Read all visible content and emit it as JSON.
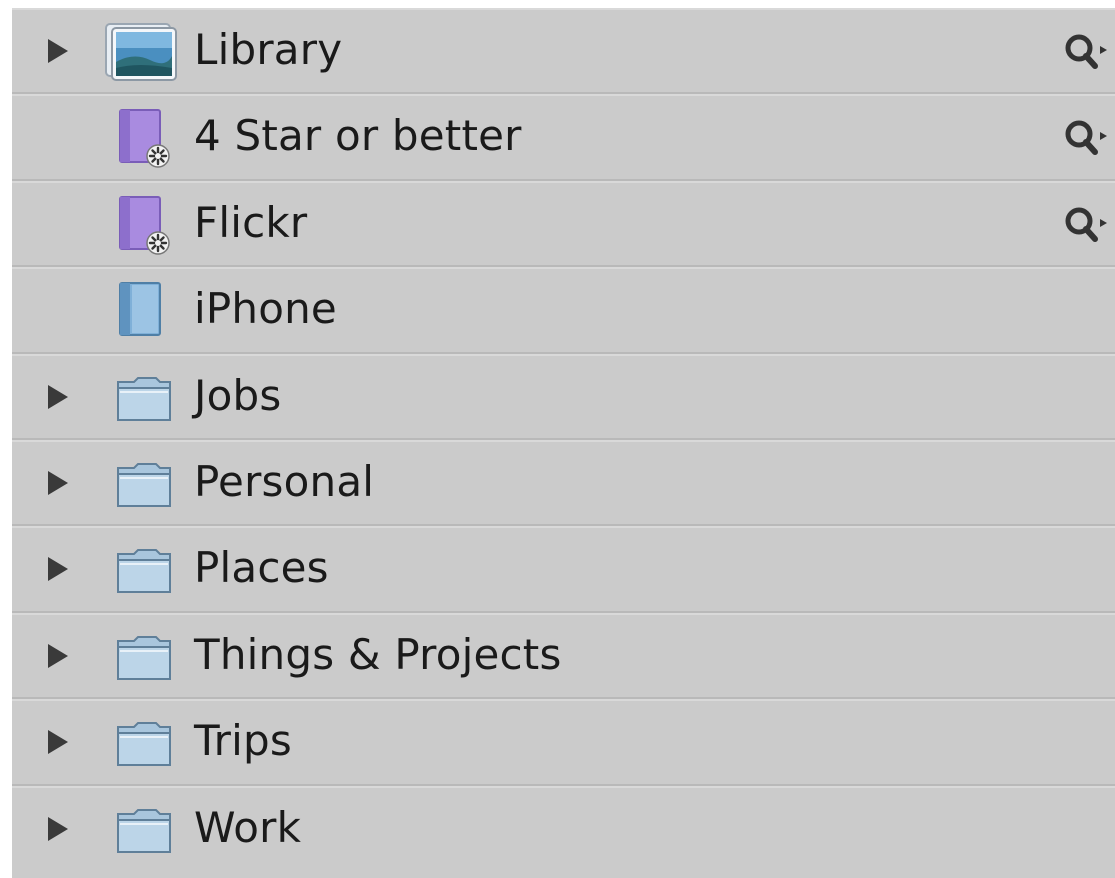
{
  "sidebar": {
    "items": [
      {
        "label": "Library",
        "icon": "library-photos-icon",
        "expandable": true,
        "search": true
      },
      {
        "label": "4 Star or better",
        "icon": "smart-album-icon",
        "expandable": false,
        "search": true
      },
      {
        "label": "Flickr",
        "icon": "smart-album-icon",
        "expandable": false,
        "search": true
      },
      {
        "label": "iPhone",
        "icon": "album-icon",
        "expandable": false,
        "search": false
      },
      {
        "label": "Jobs",
        "icon": "folder-icon",
        "expandable": true,
        "search": false
      },
      {
        "label": "Personal",
        "icon": "folder-icon",
        "expandable": true,
        "search": false
      },
      {
        "label": "Places",
        "icon": "folder-icon",
        "expandable": true,
        "search": false
      },
      {
        "label": "Things & Projects",
        "icon": "folder-icon",
        "expandable": true,
        "search": false
      },
      {
        "label": "Trips",
        "icon": "folder-icon",
        "expandable": true,
        "search": false
      },
      {
        "label": "Work",
        "icon": "folder-icon",
        "expandable": true,
        "search": false
      }
    ]
  },
  "colors": {
    "panel_bg": "#cbcbcb",
    "divider": "#b9b9b9",
    "text": "#1a1a1a",
    "smart_album_purple": "#9a7fd1",
    "folder_blue": "#8fb3cf"
  }
}
